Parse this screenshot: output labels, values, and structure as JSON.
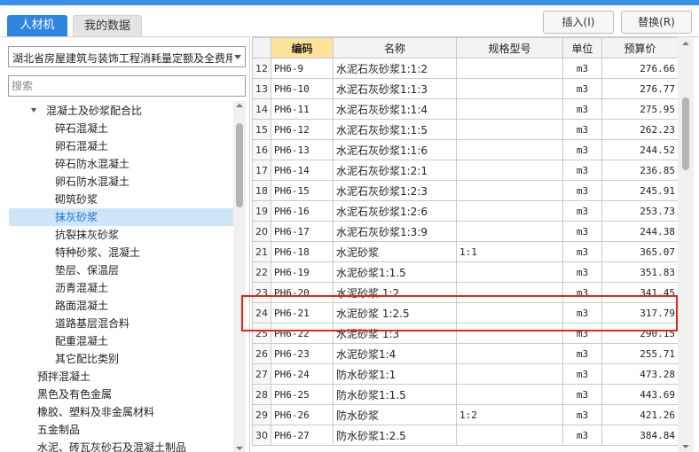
{
  "tabs": [
    {
      "label": "人材机"
    },
    {
      "label": "我的数据"
    }
  ],
  "toolbar": {
    "insert_label": "插入(I)",
    "replace_label": "替换(R)"
  },
  "left": {
    "selected_library": "湖北省房屋建筑与装饰工程消耗量定额及全费用",
    "search_placeholder": "搜索",
    "tree": [
      {
        "label": "混凝土及砂浆配合比",
        "level": 1,
        "expanded": true
      },
      {
        "label": "碎石混凝土",
        "level": 2
      },
      {
        "label": "卵石混凝土",
        "level": 2
      },
      {
        "label": "碎石防水混凝土",
        "level": 2
      },
      {
        "label": "卵石防水混凝土",
        "level": 2
      },
      {
        "label": "砌筑砂浆",
        "level": 2
      },
      {
        "label": "抹灰砂浆",
        "level": 2,
        "selected": true
      },
      {
        "label": "抗裂抹灰砂浆",
        "level": 2
      },
      {
        "label": "特种砂浆、混凝土",
        "level": 2
      },
      {
        "label": "垫层、保温层",
        "level": 2
      },
      {
        "label": "沥青混凝土",
        "level": 2
      },
      {
        "label": "路面混凝土",
        "level": 2
      },
      {
        "label": "道路基层混合料",
        "level": 2
      },
      {
        "label": "配重混凝土",
        "level": 2
      },
      {
        "label": "其它配比类别",
        "level": 2
      },
      {
        "label": "预拌混凝土",
        "level": 0
      },
      {
        "label": "黑色及有色金属",
        "level": 0
      },
      {
        "label": "橡胶、塑料及非金属材料",
        "level": 0
      },
      {
        "label": "五金制品",
        "level": 0
      },
      {
        "label": "水泥、砖瓦灰砂石及混凝土制品",
        "level": 0
      }
    ]
  },
  "table": {
    "headers": [
      "编码",
      "名称",
      "规格型号",
      "单位",
      "预算价"
    ],
    "rows": [
      {
        "no": "12",
        "code": "PH6-9",
        "name": "水泥石灰砂浆1:1:2",
        "spec": "",
        "unit": "m3",
        "price": "276.66"
      },
      {
        "no": "13",
        "code": "PH6-10",
        "name": "水泥石灰砂浆1:1:3",
        "spec": "",
        "unit": "m3",
        "price": "276.77"
      },
      {
        "no": "14",
        "code": "PH6-11",
        "name": "水泥石灰砂浆1:1:4",
        "spec": "",
        "unit": "m3",
        "price": "275.95"
      },
      {
        "no": "15",
        "code": "PH6-12",
        "name": "水泥石灰砂浆1:1:5",
        "spec": "",
        "unit": "m3",
        "price": "262.23"
      },
      {
        "no": "16",
        "code": "PH6-13",
        "name": "水泥石灰砂浆1:1:6",
        "spec": "",
        "unit": "m3",
        "price": "244.52"
      },
      {
        "no": "17",
        "code": "PH6-14",
        "name": "水泥石灰砂浆1:2:1",
        "spec": "",
        "unit": "m3",
        "price": "236.85"
      },
      {
        "no": "18",
        "code": "PH6-15",
        "name": "水泥石灰砂浆1:2:3",
        "spec": "",
        "unit": "m3",
        "price": "245.91"
      },
      {
        "no": "19",
        "code": "PH6-16",
        "name": "水泥石灰砂浆1:2:6",
        "spec": "",
        "unit": "m3",
        "price": "253.73"
      },
      {
        "no": "20",
        "code": "PH6-17",
        "name": "水泥石灰砂浆1:3:9",
        "spec": "",
        "unit": "m3",
        "price": "244.38"
      },
      {
        "no": "21",
        "code": "PH6-18",
        "name": "水泥砂浆",
        "spec": "1:1",
        "unit": "m3",
        "price": "365.07"
      },
      {
        "no": "22",
        "code": "PH6-19",
        "name": "水泥砂浆1:1.5",
        "spec": "",
        "unit": "m3",
        "price": "351.83"
      },
      {
        "no": "23",
        "code": "PH6-20",
        "name": "水泥砂浆 1:2",
        "spec": "",
        "unit": "m3",
        "price": "341.45"
      },
      {
        "no": "24",
        "code": "PH6-21",
        "name": "水泥砂浆 1:2.5",
        "spec": "",
        "unit": "m3",
        "price": "317.79"
      },
      {
        "no": "25",
        "code": "PH6-22",
        "name": "水泥砂浆 1:3",
        "spec": "",
        "unit": "m3",
        "price": "290.15"
      },
      {
        "no": "26",
        "code": "PH6-23",
        "name": "水泥砂浆1:4",
        "spec": "",
        "unit": "m3",
        "price": "255.71"
      },
      {
        "no": "27",
        "code": "PH6-24",
        "name": "防水砂浆1:1",
        "spec": "",
        "unit": "m3",
        "price": "473.28"
      },
      {
        "no": "28",
        "code": "PH6-25",
        "name": "防水砂浆1:1.5",
        "spec": "",
        "unit": "m3",
        "price": "443.69"
      },
      {
        "no": "29",
        "code": "PH6-26",
        "name": "防水砂浆",
        "spec": "1:2",
        "unit": "m3",
        "price": "421.26"
      },
      {
        "no": "30",
        "code": "PH6-27",
        "name": "防水砂浆1:2.5",
        "spec": "",
        "unit": "m3",
        "price": "384.84"
      }
    ]
  },
  "colors": {
    "accent": "#2f86e0",
    "highlight": "#e8221a",
    "header_highlight": "#ffe39a",
    "selected_row": "#cce6f8"
  }
}
